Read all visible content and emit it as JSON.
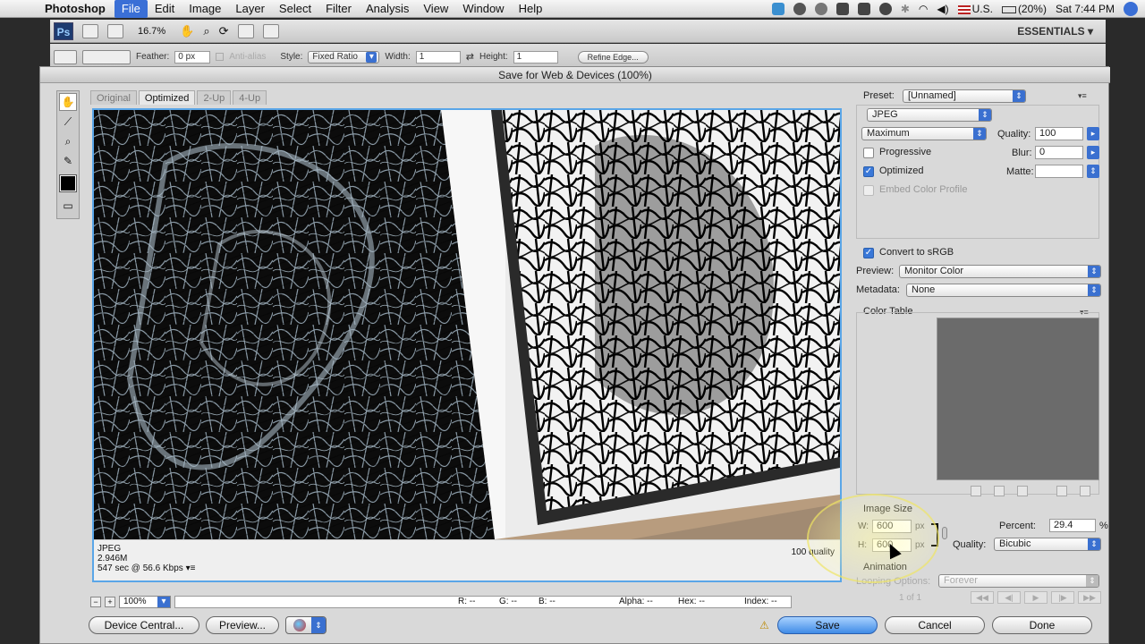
{
  "menubar": {
    "app_name": "Photoshop",
    "items": [
      "File",
      "Edit",
      "Image",
      "Layer",
      "Select",
      "Filter",
      "Analysis",
      "View",
      "Window",
      "Help"
    ],
    "active_index": 0,
    "locale": "U.S.",
    "battery": "(20%)",
    "clock": "Sat 7:44 PM"
  },
  "appbar": {
    "logo": "Ps",
    "zoom": "16.7%",
    "workspace": "ESSENTIALS ▾"
  },
  "options": {
    "feather_label": "Feather:",
    "feather_value": "0 px",
    "antialias_label": "Anti-alias",
    "style_label": "Style:",
    "style_value": "Fixed Ratio",
    "width_label": "Width:",
    "width_value": "1",
    "height_label": "Height:",
    "height_value": "1",
    "refine_edge": "Refine Edge..."
  },
  "dialog": {
    "title": "Save for Web & Devices (100%)",
    "tabs": [
      "Original",
      "Optimized",
      "2-Up",
      "4-Up"
    ],
    "active_tab": 1,
    "status": {
      "format": "JPEG",
      "size": "2.946M",
      "time": "547 sec @ 56.6 Kbps",
      "quality": "100 quality"
    },
    "zoom_value": "100%",
    "readouts": {
      "r": "R: --",
      "g": "G: --",
      "b": "B: --",
      "alpha": "Alpha: --",
      "hex": "Hex: --",
      "index": "Index: --"
    },
    "buttons": {
      "device_central": "Device Central...",
      "preview": "Preview...",
      "save": "Save",
      "cancel": "Cancel",
      "done": "Done"
    }
  },
  "settings": {
    "preset_label": "Preset:",
    "preset_value": "[Unnamed]",
    "format_value": "JPEG",
    "compression_value": "Maximum",
    "quality_label": "Quality:",
    "quality_value": "100",
    "blur_label": "Blur:",
    "blur_value": "0",
    "matte_label": "Matte:",
    "matte_value": "",
    "progressive_label": "Progressive",
    "progressive_checked": false,
    "optimized_label": "Optimized",
    "optimized_checked": true,
    "embed_label": "Embed Color Profile",
    "embed_checked": false,
    "convert_label": "Convert to sRGB",
    "convert_checked": true,
    "preview_label": "Preview:",
    "preview_value": "Monitor Color",
    "metadata_label": "Metadata:",
    "metadata_value": "None",
    "color_table_label": "Color Table",
    "image_size_label": "Image Size",
    "w_label": "W:",
    "w_value": "600",
    "h_label": "H:",
    "h_value": "600",
    "unit": "px",
    "percent_label": "Percent:",
    "percent_value": "29.4",
    "percent_unit": "%",
    "resample_label": "Quality:",
    "resample_value": "Bicubic",
    "animation_label": "Animation",
    "looping_label": "Looping Options:",
    "looping_value": "Forever",
    "frame_counter": "1 of 1"
  },
  "colors": {
    "accent": "#3a70d0",
    "preview_border": "#5aa6e8"
  }
}
